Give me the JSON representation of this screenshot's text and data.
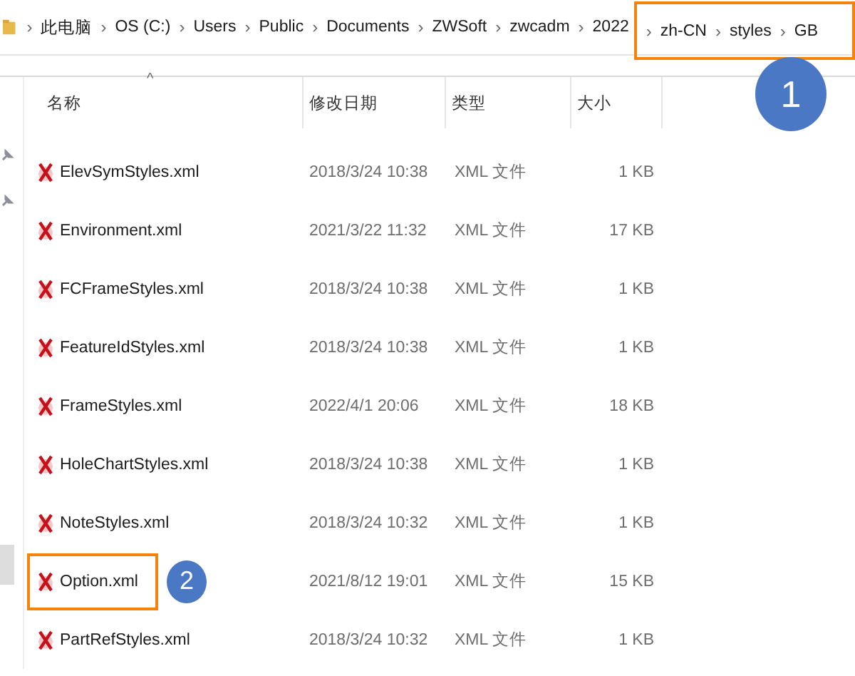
{
  "breadcrumb": [
    "此电脑",
    "OS (C:)",
    "Users",
    "Public",
    "Documents",
    "ZWSoft",
    "zwcadm",
    "2022"
  ],
  "breadcrumb_highlighted": [
    "zh-CN",
    "styles",
    "GB"
  ],
  "breadcrumb_separator": "›",
  "callout": "1",
  "columns": [
    {
      "label": "名称",
      "sorted": true
    },
    {
      "label": "修改日期",
      "sorted": false
    },
    {
      "label": "类型",
      "sorted": false
    },
    {
      "label": "大小",
      "sorted": false
    }
  ],
  "sort_indicator": "^",
  "files": [
    {
      "name": "ElevSymStyles.xml",
      "modified": "2018/3/24 10:38",
      "type": "XML 文件",
      "size": "1 KB",
      "highlighted": false
    },
    {
      "name": "Environment.xml",
      "modified": "2021/3/22 11:32",
      "type": "XML 文件",
      "size": "17 KB",
      "highlighted": false
    },
    {
      "name": "FCFrameStyles.xml",
      "modified": "2018/3/24 10:38",
      "type": "XML 文件",
      "size": "1 KB",
      "highlighted": false
    },
    {
      "name": "FeatureIdStyles.xml",
      "modified": "2018/3/24 10:38",
      "type": "XML 文件",
      "size": "1 KB",
      "highlighted": false
    },
    {
      "name": "FrameStyles.xml",
      "modified": "2022/4/1 20:06",
      "type": "XML 文件",
      "size": "18 KB",
      "highlighted": false
    },
    {
      "name": "HoleChartStyles.xml",
      "modified": "2018/3/24 10:38",
      "type": "XML 文件",
      "size": "1 KB",
      "highlighted": false
    },
    {
      "name": "NoteStyles.xml",
      "modified": "2018/3/24 10:32",
      "type": "XML 文件",
      "size": "1 KB",
      "highlighted": false
    },
    {
      "name": "Option.xml",
      "modified": "2021/8/12 19:01",
      "type": "XML 文件",
      "size": "15 KB",
      "highlighted": true,
      "callout": "2"
    },
    {
      "name": "PartRefStyles.xml",
      "modified": "2018/3/24 10:32",
      "type": "XML 文件",
      "size": "1 KB",
      "highlighted": false
    }
  ]
}
